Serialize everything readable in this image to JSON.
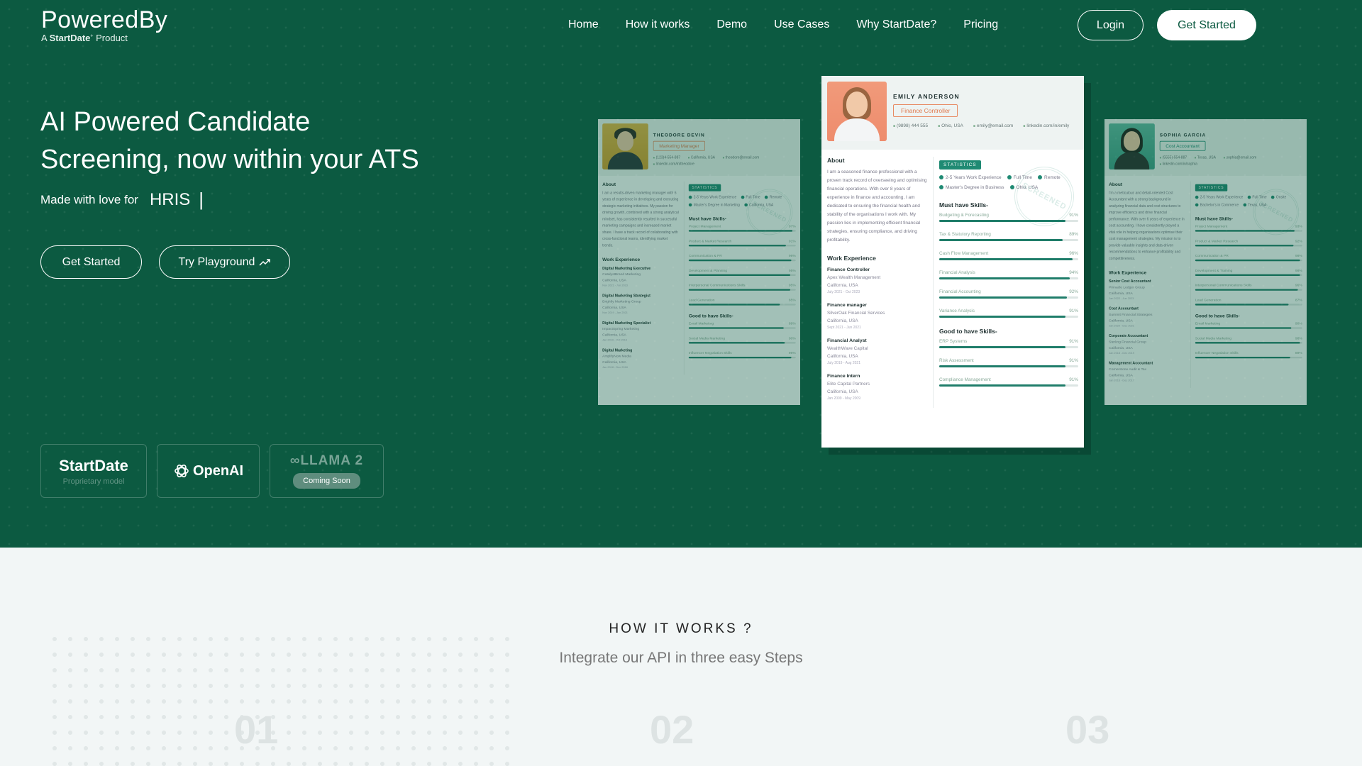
{
  "logo": {
    "name": "PoweredBy",
    "tagline_prefix": "A",
    "tagline_brand": "StartDate",
    "tagline_suffix": "Product"
  },
  "nav": {
    "items": [
      "Home",
      "How it works",
      "Demo",
      "Use Cases",
      "Why StartDate?",
      "Pricing"
    ],
    "login": "Login",
    "get_started": "Get Started"
  },
  "hero": {
    "headline_line1": "AI Powered Candidate",
    "headline_line2": "Screening, now within your ATS",
    "tagline_prefix": "Made with love for",
    "tagline_word": "HRIS",
    "tagline_caret": "|",
    "btn_get_started": "Get Started",
    "btn_playground": "Try Playground",
    "playground_icon": "trend-up-arrow-icon"
  },
  "models": [
    {
      "name": "StartDate",
      "note": "Proprietary model"
    },
    {
      "name": "OpenAI",
      "icon": "openai-knot-icon"
    },
    {
      "name": "LLAMA 2",
      "badge": "Coming Soon",
      "icon": "meta-infinity-icon"
    }
  ],
  "resumes": {
    "left": {
      "name": "THEODORE DEVIN",
      "role": "Marketing Manager",
      "contact": [
        "(123)4-554-887",
        "California, USA",
        "theodore@email.com",
        "linkedin.com/in/theodore"
      ],
      "about_title": "About",
      "about": "I am a results-driven marketing manager with 6 years of experience in developing and executing strategic marketing initiatives. My passion for driving growth, combined with a strong analytical mindset, has consistently resulted in successful marketing campaigns and increased market share. I have a track record of collaborating with cross-functional teams, identifying market trends.",
      "work_title": "Work Experience",
      "jobs": [
        {
          "title": "Digital Marketing Executive",
          "company": "CatalystBrand Marketing",
          "location": "California, USA",
          "dates": "Nov 2021 - Jan 2023"
        },
        {
          "title": "Digital Marketing Strategist",
          "company": "Brightly Marketing Group",
          "location": "California, USA",
          "dates": "Nov 2019 - Jan 2021"
        },
        {
          "title": "Digital Marketing Specialist",
          "company": "ImpactSpring Marketing",
          "location": "California, USA",
          "dates": "Jan 2019 - Oct 2019"
        },
        {
          "title": "Digital Marketing",
          "company": "AmplifyNow Media",
          "location": "California, USA",
          "dates": "Jan 2018 - Dec 2018"
        }
      ],
      "stat_label": "STATISTICS",
      "stats": [
        "2-5 Years Work Experience",
        "Full Time",
        "Remote",
        "Master's Degree in Marketing",
        "California, USA"
      ],
      "must_title": "Must have Skills-",
      "must": [
        {
          "name": "Project Management",
          "pct": "97%"
        },
        {
          "name": "Product & Market Research",
          "pct": "91%"
        },
        {
          "name": "Communication & PR",
          "pct": "96%"
        },
        {
          "name": "Development & Planning",
          "pct": "95%"
        },
        {
          "name": "Interpersonal Communications Skills",
          "pct": "95%"
        },
        {
          "name": "Lead Generation",
          "pct": "85%"
        }
      ],
      "good_title": "Good to have Skills-",
      "good": [
        {
          "name": "Email Marketing",
          "pct": "89%"
        },
        {
          "name": "Social Media Marketing",
          "pct": "90%"
        },
        {
          "name": "Influencer Negotiation Skills",
          "pct": "96%"
        }
      ]
    },
    "center": {
      "name": "EMILY ANDERSON",
      "role": "Finance Controller",
      "contact": [
        "(9898) 444 555",
        "Ohio, USA",
        "emily@email.com",
        "linkedin.com/in/emily"
      ],
      "about_title": "About",
      "about": "I am a seasoned finance professional with a proven track record of overseeing and optimising financial operations. With over 8 years of experience in finance and accounting, I am dedicated to ensuring the financial health and stability of the organisations I work with. My passion lies in implementing efficient financial strategies, ensuring compliance, and driving profitability.",
      "work_title": "Work Experience",
      "jobs": [
        {
          "title": "Finance Controller",
          "company": "Apex Wealth Management",
          "location": "California, USA",
          "dates": "July 2021 - Oct 2023"
        },
        {
          "title": "Finance manager",
          "company": "SilverOak Financial Services",
          "location": "California, USA",
          "dates": "Sept 2021 - Jun 2021"
        },
        {
          "title": "Financial Analyst",
          "company": "WealthWave Capital",
          "location": "California, USA",
          "dates": "July 2019 - Aug 2021"
        },
        {
          "title": "Finance Intern",
          "company": "Elite Capital Partners",
          "location": "California, USA",
          "dates": "Jan 2009 - May 2009"
        }
      ],
      "stat_label": "STATISTICS",
      "stats": [
        "2-5 Years Work Experience",
        "Full Time",
        "Remote",
        "Master's Degree in Business",
        "Ohio, USA"
      ],
      "must_title": "Must have Skills-",
      "must": [
        {
          "name": "Budgeting & Forecasting",
          "pct": "91%"
        },
        {
          "name": "Tax & Statutory Reporting",
          "pct": "89%"
        },
        {
          "name": "Cash Flow Management",
          "pct": "96%"
        },
        {
          "name": "Financial Analysis",
          "pct": "94%"
        },
        {
          "name": "Financial Accounting",
          "pct": "92%"
        },
        {
          "name": "Variance Analysis",
          "pct": "91%"
        }
      ],
      "good_title": "Good to have Skills-",
      "good": [
        {
          "name": "ERP Systems",
          "pct": "91%"
        },
        {
          "name": "Risk Assessment",
          "pct": "91%"
        },
        {
          "name": "Compliance Management",
          "pct": "91%"
        }
      ]
    },
    "right": {
      "name": "SOPHIA GARCIA",
      "role": "Cost Accountant",
      "contact": [
        "(5555)-554-887",
        "Texas, USA",
        "sophia@email.com",
        "linkedin.com/in/sophia"
      ],
      "about_title": "About",
      "about": "I'm a meticulous and detail-oriented Cost Accountant with a strong background in analyzing financial data and cost structures to improve efficiency and drive financial performance. With over 6 years of experience in cost accounting, I have consistently played a vital role in helping organisations optimise their cost management strategies. My mission is to provide valuable insights and data-driven recommendations to enhance profitability and competitiveness.",
      "work_title": "Work Experience",
      "jobs": [
        {
          "title": "Senior Cost Accountant",
          "company": "Pinnacle Ledger Group",
          "location": "California, USA",
          "dates": "Jan 2022 - Jun 2023"
        },
        {
          "title": "Cost Accountant",
          "company": "Summit Financial Strategies",
          "location": "California, USA",
          "dates": "Jan 2020 - Dec 2021"
        },
        {
          "title": "Corporate Accountant",
          "company": "Sterling Financial Group",
          "location": "California, USA",
          "dates": "Jan 2018 - Dec 2019"
        },
        {
          "title": "Management Accountant",
          "company": "Cornerstone Audit & Tax",
          "location": "California, USA",
          "dates": "Jan 2016 - Dec 2017"
        }
      ],
      "stat_label": "STATISTICS",
      "stats": [
        "2-5 Years Work Experience",
        "Full Time",
        "Onsite",
        "Bachelor's in Commerce",
        "Texas, USA"
      ],
      "must_title": "Must have Skills-",
      "must": [
        {
          "name": "Project Management",
          "pct": "93%"
        },
        {
          "name": "Product & Market Research",
          "pct": "92%"
        },
        {
          "name": "Communication & PR",
          "pct": "98%"
        },
        {
          "name": "Development & Training",
          "pct": "98%"
        },
        {
          "name": "Interpersonal Communications Skills",
          "pct": "96%"
        },
        {
          "name": "Lead Generation",
          "pct": "87%"
        }
      ],
      "good_title": "Good to have Skills-",
      "good": [
        {
          "name": "Email Marketing",
          "pct": "90%"
        },
        {
          "name": "Social Media Marketing",
          "pct": "98%"
        },
        {
          "name": "Influencer Negotiation Skills",
          "pct": "89%"
        }
      ]
    }
  },
  "how": {
    "title": "HOW IT WORKS ?",
    "subtitle": "Integrate our API in three easy Steps",
    "steps": [
      "01",
      "02",
      "03"
    ]
  },
  "colors": {
    "brand_green": "#0c5a41",
    "accent_teal": "#1f8a73",
    "role_orange": "#e07a4f"
  }
}
